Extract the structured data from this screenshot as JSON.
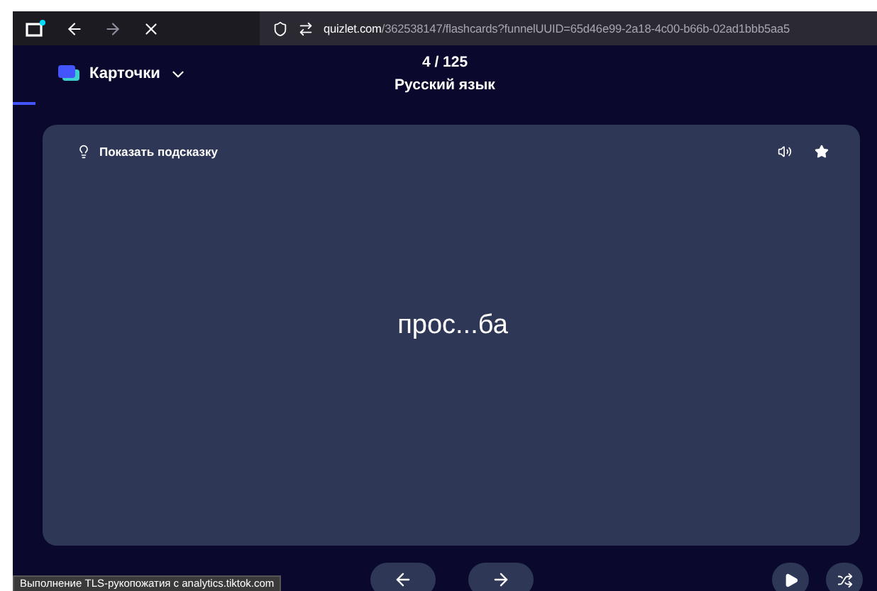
{
  "browser": {
    "url_host": "quizlet.com",
    "url_path": "/362538147/flashcards?funnelUUID=65d46e99-2a18-4c00-b66b-02ad1bbb5aa5"
  },
  "header": {
    "mode": "Карточки",
    "progress": "4 / 125",
    "set_title": "Русский язык"
  },
  "card": {
    "hint": "Показать подсказку",
    "term": "прос...ба",
    "starred": false
  },
  "status_bar": "Выполнение TLS-рукопожатия с analytics.tiktok.com"
}
